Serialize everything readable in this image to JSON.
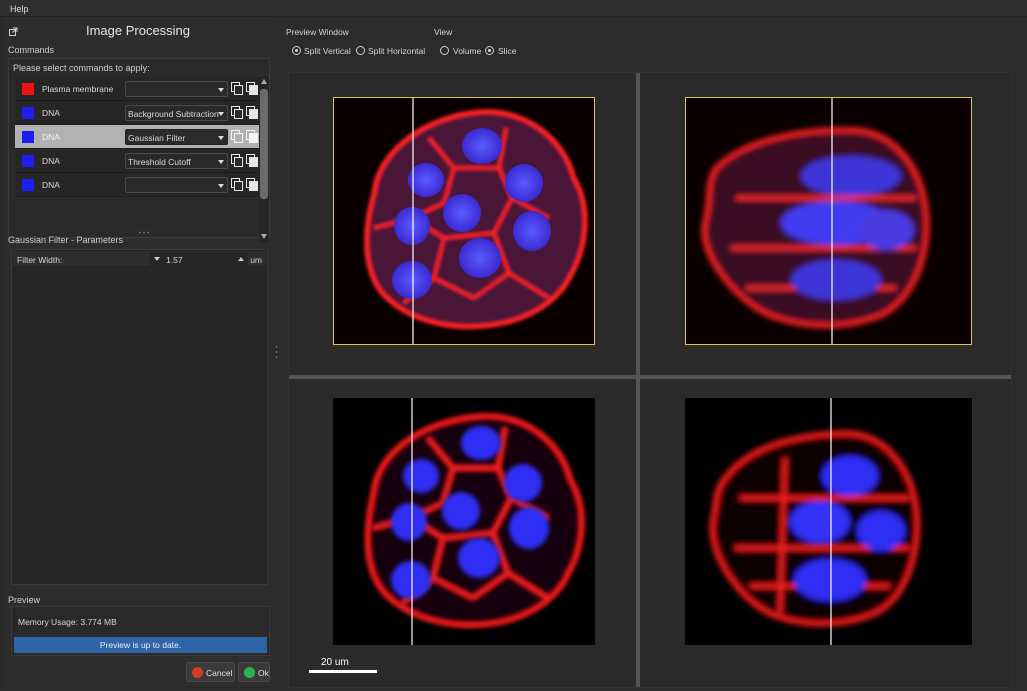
{
  "menu": {
    "help": "Help"
  },
  "left_panel": {
    "title": "Image Processing",
    "commands_label": "Commands",
    "commands_hint": "Please select commands to apply:",
    "commands": [
      {
        "channel": "Plasma membrane",
        "color": "#ee1111",
        "command": ""
      },
      {
        "channel": "DNA",
        "color": "#1d1df0",
        "command": "Background Subtraction"
      },
      {
        "channel": "DNA",
        "color": "#1d1df0",
        "command": "Gaussian Filter",
        "selected": true
      },
      {
        "channel": "DNA",
        "color": "#1d1df0",
        "command": "Threshold Cutoff"
      },
      {
        "channel": "DNA",
        "color": "#1d1df0",
        "command": ""
      }
    ],
    "params_label": "Gaussian Filter - Parameters",
    "param": {
      "name": "Filter Width:",
      "value": "1.57",
      "unit": "um"
    },
    "preview_label": "Preview",
    "memory": "Memory Usage: 3.774 MB",
    "status": "Preview is up to date.",
    "cancel": "Cancel",
    "ok": "Ok"
  },
  "right_panel": {
    "preview_window_label": "Preview Window",
    "split_vertical": "Split Vertical",
    "split_horizontal": "Split Horizontal",
    "view_label": "View",
    "volume": "Volume",
    "slice": "Slice",
    "preview_window_selected": "Split Vertical",
    "view_selected": "Slice",
    "scale_bar": "20 um"
  },
  "colors": {
    "membrane": "#ff2020",
    "nucleus": "#2a2aff",
    "selection_frame": "#d8c640",
    "status_bar": "#2f64a8",
    "cancel_dot": "#d23a2a",
    "ok_dot": "#29b34a"
  }
}
